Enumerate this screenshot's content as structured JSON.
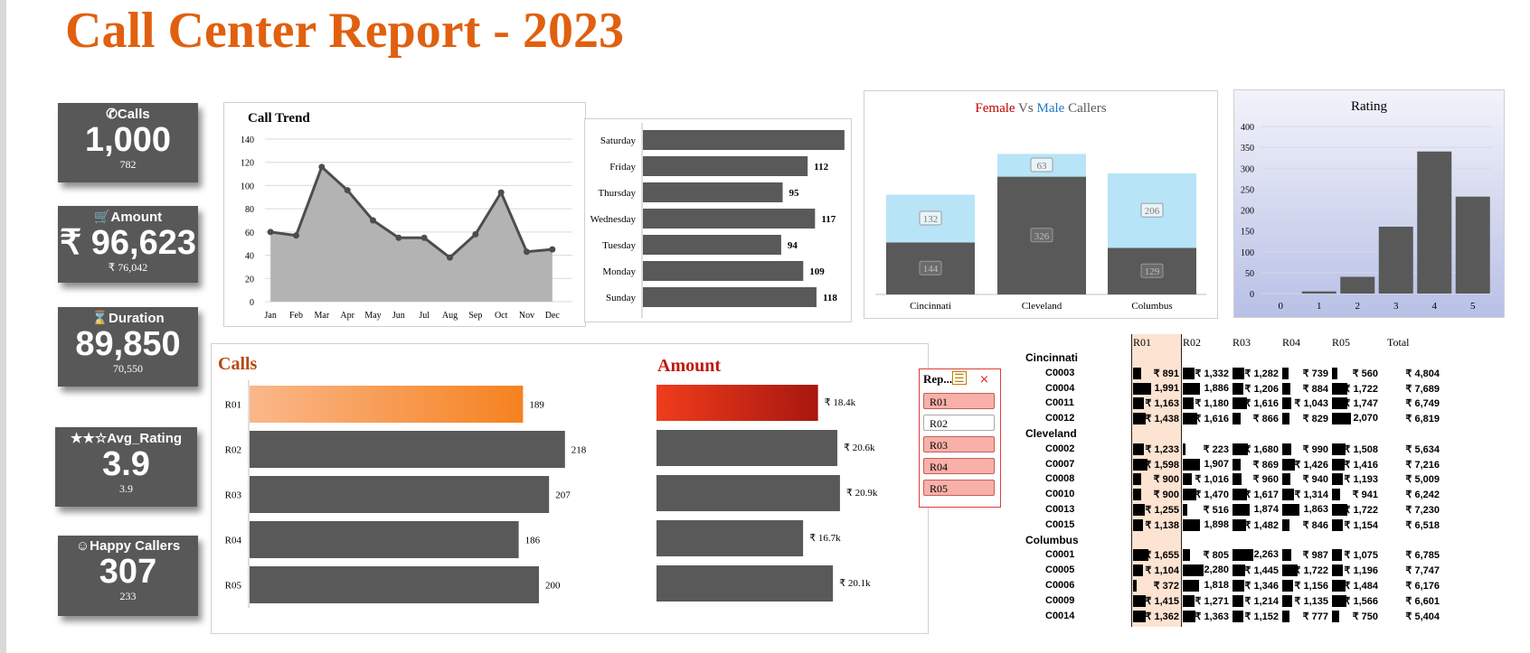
{
  "title": "Call Center Report - 2023",
  "kpis": [
    {
      "icon": "phone-icon",
      "glyph": "✆",
      "label": "Calls",
      "value": "1,000",
      "sub": "782"
    },
    {
      "icon": "cart-icon",
      "glyph": "🛒",
      "label": "Amount",
      "value": "₹ 96,623",
      "sub": "₹ 76,042"
    },
    {
      "icon": "hourglass-icon",
      "glyph": "⌛",
      "label": "Duration",
      "value": "89,850",
      "sub": "70,550"
    },
    {
      "icon": "stars-icon",
      "glyph": "★★☆",
      "label": "Avg_Rating",
      "value": "3.9",
      "sub": "3.9"
    },
    {
      "icon": "smiley-icon",
      "glyph": "☺",
      "label": "Happy Callers",
      "value": "307",
      "sub": "233"
    }
  ],
  "colors": {
    "accent": "#e0600f",
    "bar": "#595959",
    "area": "#b3b3b3",
    "female": "#b7e4f7",
    "calls_highlight": "#f58220",
    "amount_highlight": "#d9261c",
    "slicer_selected": "#f8b0a8",
    "title_female": "#c00000",
    "title_male": "#1f78c8"
  },
  "chart_data": [
    {
      "id": "call_trend",
      "type": "area",
      "title": "Call Trend",
      "categories": [
        "Jan",
        "Feb",
        "Mar",
        "Apr",
        "May",
        "Jun",
        "Jul",
        "Aug",
        "Sep",
        "Oct",
        "Nov",
        "Dec"
      ],
      "values": [
        60,
        57,
        116,
        96,
        70,
        55,
        55,
        38,
        58,
        94,
        43,
        45
      ],
      "ylim": [
        0,
        140
      ],
      "yticks": [
        0,
        20,
        40,
        60,
        80,
        100,
        120,
        140
      ]
    },
    {
      "id": "weekday",
      "type": "bar",
      "orientation": "horizontal",
      "categories": [
        "Saturday",
        "Friday",
        "Thursday",
        "Wednesday",
        "Tuesday",
        "Monday",
        "Sunday"
      ],
      "values": [
        137,
        112,
        95,
        117,
        94,
        109,
        118
      ],
      "xlim": [
        0,
        150
      ]
    },
    {
      "id": "gender",
      "type": "bar",
      "stacked": true,
      "title_parts": [
        "Female",
        " Vs ",
        "Male",
        " Callers"
      ],
      "categories": [
        "Cincinnati",
        "Cleveland",
        "Columbus"
      ],
      "series": [
        {
          "values": [
            144,
            326,
            129
          ]
        },
        {
          "values": [
            132,
            63,
            206
          ]
        }
      ],
      "ylim": [
        0,
        500
      ]
    },
    {
      "id": "rating",
      "type": "bar",
      "title": "Rating",
      "categories": [
        "0",
        "1",
        "2",
        "3",
        "4",
        "5"
      ],
      "values": [
        0,
        5,
        40,
        160,
        340,
        232
      ],
      "ylim": [
        0,
        400
      ],
      "yticks": [
        0,
        50,
        100,
        150,
        200,
        250,
        300,
        350,
        400
      ]
    },
    {
      "id": "calls_rep",
      "type": "bar",
      "orientation": "horizontal",
      "title": "Calls",
      "categories": [
        "R01",
        "R02",
        "R03",
        "R04",
        "R05"
      ],
      "values": [
        189,
        218,
        207,
        186,
        200
      ],
      "labels": [
        "189",
        "218",
        "207",
        "186",
        "200"
      ],
      "highlight": 0,
      "xlim": [
        0,
        240
      ]
    },
    {
      "id": "amount_rep",
      "type": "bar",
      "orientation": "horizontal",
      "title": "Amount",
      "categories": [
        "R01",
        "R02",
        "R03",
        "R04",
        "R05"
      ],
      "values": [
        18.4,
        20.6,
        20.9,
        16.7,
        20.1
      ],
      "labels": [
        "₹ 18.4k",
        "₹ 20.6k",
        "₹ 20.9k",
        "₹ 16.7k",
        "₹ 20.1k"
      ],
      "highlight": 0,
      "xlim": [
        0,
        24
      ]
    }
  ],
  "slicer": {
    "header": "Rep...",
    "items": [
      {
        "label": "R01",
        "selected": true
      },
      {
        "label": "R02",
        "selected": false
      },
      {
        "label": "R03",
        "selected": true
      },
      {
        "label": "R04",
        "selected": true
      },
      {
        "label": "R05",
        "selected": true
      }
    ]
  },
  "pivot": {
    "headers": [
      "R01",
      "R02",
      "R03",
      "R04",
      "R05",
      "Total"
    ],
    "groups": [
      {
        "city": "Cincinnati",
        "rows": [
          {
            "code": "C0003",
            "cells": [
              "₹ 891",
              "₹ 1,332",
              "₹ 1,282",
              "₹ 739",
              "₹ 560"
            ],
            "total": "₹ 4,804"
          },
          {
            "code": "C0004",
            "cells": [
              "1,991",
              "1,886",
              "₹ 1,206",
              "₹ 884",
              "₹ 1,722"
            ],
            "total": "₹ 7,689"
          },
          {
            "code": "C0011",
            "cells": [
              "₹ 1,163",
              "₹ 1,180",
              "₹ 1,616",
              "₹ 1,043",
              "₹ 1,747"
            ],
            "total": "₹ 6,749"
          },
          {
            "code": "C0012",
            "cells": [
              "₹ 1,438",
              "₹ 1,616",
              "₹ 866",
              "₹ 829",
              "2,070"
            ],
            "total": "₹ 6,819"
          }
        ]
      },
      {
        "city": "Cleveland",
        "rows": [
          {
            "code": "C0002",
            "cells": [
              "₹ 1,233",
              "₹ 223",
              "₹ 1,680",
              "₹ 990",
              "₹ 1,508"
            ],
            "total": "₹ 5,634"
          },
          {
            "code": "C0007",
            "cells": [
              "₹ 1,598",
              "1,907",
              "₹ 869",
              "₹ 1,426",
              "₹ 1,416"
            ],
            "total": "₹ 7,216"
          },
          {
            "code": "C0008",
            "cells": [
              "₹ 900",
              "₹ 1,016",
              "₹ 960",
              "₹ 940",
              "₹ 1,193"
            ],
            "total": "₹ 5,009"
          },
          {
            "code": "C0010",
            "cells": [
              "₹ 900",
              "₹ 1,470",
              "₹ 1,617",
              "₹ 1,314",
              "₹ 941"
            ],
            "total": "₹ 6,242"
          },
          {
            "code": "C0013",
            "cells": [
              "₹ 1,255",
              "₹ 516",
              "1,874",
              "1,863",
              "₹ 1,722"
            ],
            "total": "₹ 7,230"
          },
          {
            "code": "C0015",
            "cells": [
              "₹ 1,138",
              "1,898",
              "₹ 1,482",
              "₹ 846",
              "₹ 1,154"
            ],
            "total": "₹ 6,518"
          }
        ]
      },
      {
        "city": "Columbus",
        "rows": [
          {
            "code": "C0001",
            "cells": [
              "₹ 1,655",
              "₹ 805",
              "2,263",
              "₹ 987",
              "₹ 1,075"
            ],
            "total": "₹ 6,785"
          },
          {
            "code": "C0005",
            "cells": [
              "₹ 1,104",
              "2,280",
              "₹ 1,445",
              "₹ 1,722",
              "₹ 1,196"
            ],
            "total": "₹ 7,747"
          },
          {
            "code": "C0006",
            "cells": [
              "₹ 372",
              "1,818",
              "₹ 1,346",
              "₹ 1,156",
              "₹ 1,484"
            ],
            "total": "₹ 6,176"
          },
          {
            "code": "C0009",
            "cells": [
              "₹ 1,415",
              "₹ 1,271",
              "₹ 1,214",
              "₹ 1,135",
              "₹ 1,566"
            ],
            "total": "₹ 6,601"
          },
          {
            "code": "C0014",
            "cells": [
              "₹ 1,362",
              "₹ 1,363",
              "₹ 1,152",
              "₹ 777",
              "₹ 750"
            ],
            "total": "₹ 5,404"
          }
        ]
      }
    ]
  }
}
